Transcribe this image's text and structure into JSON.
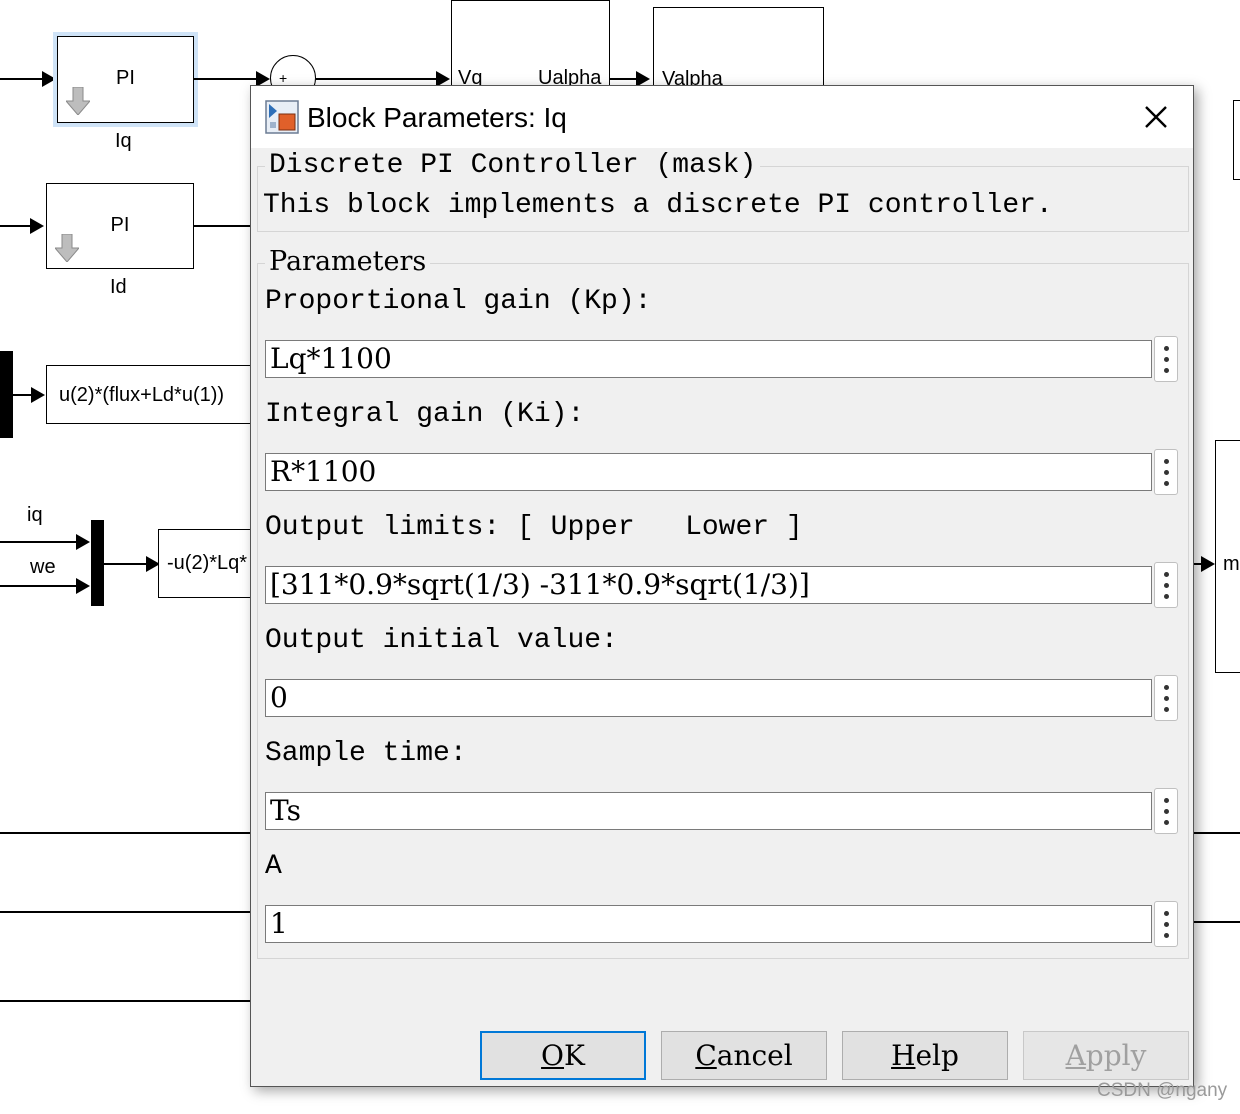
{
  "canvas": {
    "pi_iq": {
      "label": "PI",
      "name": "Iq"
    },
    "pi_id": {
      "label": "PI",
      "name": "Id"
    },
    "fcn_flux": {
      "expr": "u(2)*(flux+Ld*u(1))"
    },
    "fcn_lq": {
      "expr": "-u(2)*Lq*"
    },
    "signal_iq": "iq",
    "signal_we": "we",
    "sum_sign": "+",
    "block_ualpha": {
      "port_in": "Vq",
      "port_out": "Ualpha"
    },
    "block_valpha": {
      "port_in": "Valpha"
    },
    "right_block_port": "m"
  },
  "dialog": {
    "title": "Block Parameters: Iq",
    "mask_group": {
      "legend": "Discrete PI Controller (mask)",
      "description": "This block implements a discrete PI controller."
    },
    "params_group": {
      "legend": "Parameters",
      "fields": [
        {
          "label": "Proportional gain (Kp):",
          "value": "Lq*1100"
        },
        {
          "label": "Integral gain (Ki):",
          "value": "R*1100"
        },
        {
          "label": "Output limits: [ Upper   Lower ]",
          "value": "[311*0.9*sqrt(1/3) -311*0.9*sqrt(1/3)]"
        },
        {
          "label": "Output initial value:",
          "value": "0"
        },
        {
          "label": "Sample time:",
          "value": "Ts"
        },
        {
          "label": "A",
          "value": "1"
        }
      ]
    },
    "buttons": {
      "ok": {
        "key": "O",
        "rest": "K"
      },
      "cancel": {
        "key": "C",
        "rest": "ancel"
      },
      "help": {
        "key": "H",
        "rest": "elp"
      },
      "apply": {
        "key": "A",
        "rest": "pply"
      }
    }
  },
  "watermark": "CSDN @ngany"
}
